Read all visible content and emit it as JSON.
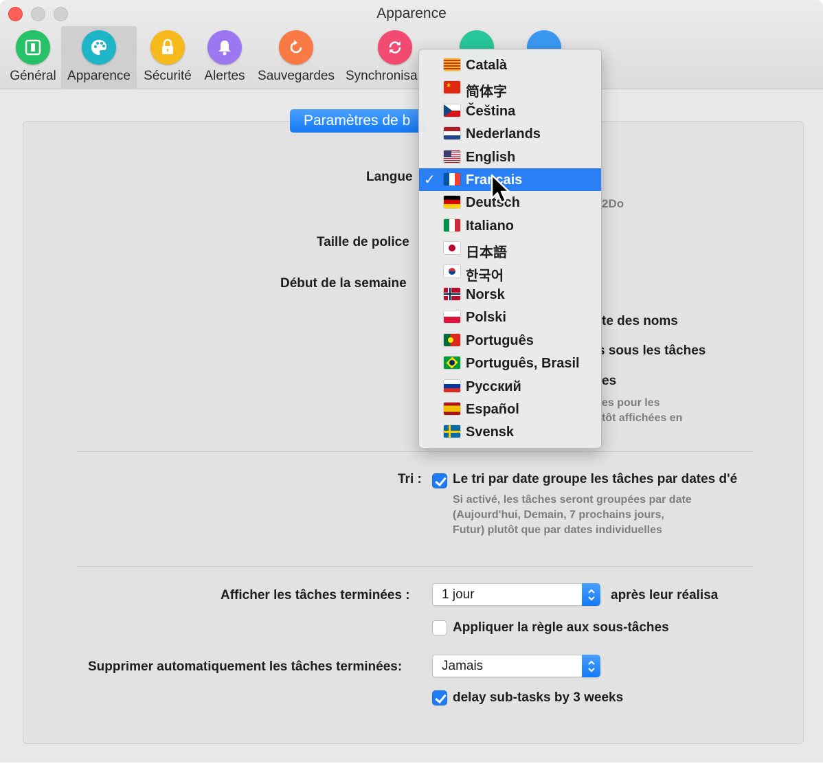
{
  "window": {
    "title": "Apparence"
  },
  "toolbar": {
    "items": [
      {
        "label": "Général",
        "color": "#27c267",
        "icon": "general-icon"
      },
      {
        "label": "Apparence",
        "color": "#1fb5c8",
        "icon": "palette-icon"
      },
      {
        "label": "Sécurité",
        "color": "#f6b91c",
        "icon": "lock-icon"
      },
      {
        "label": "Alertes",
        "color": "#9d77f1",
        "icon": "bell-icon"
      },
      {
        "label": "Sauvegardes",
        "color": "#f97a45",
        "icon": "backup-icon"
      },
      {
        "label": "Synchronisa",
        "color": "#f24a71",
        "icon": "sync-icon"
      }
    ],
    "hidden_icons": [
      {
        "color": "#27c79a",
        "icon": "sliders-icon"
      },
      {
        "color": "#3a98f3",
        "icon": "compass-icon"
      }
    ]
  },
  "segment": {
    "label": "Paramètres de b"
  },
  "form": {
    "language_label": "Langue",
    "language_hint_fragment": "2Do",
    "font_size_label": "Taille de police",
    "week_start_label": "Début de la semaine",
    "behind_menu_1": "te des noms",
    "behind_menu_2": "s sous les tâches",
    "behind_menu_3": "es",
    "behind_menu_hint": "es pour les\ntôt affichées en",
    "sort_label": "Tri :",
    "sort_checkbox_text": "Le tri par date groupe les tâches par dates d'é",
    "sort_hint": "Si activé, les tâches seront groupées par date (Aujourd'hui, Demain, 7 prochains jours, Futur) plutôt que par dates individuelles",
    "show_completed_label": "Afficher les tâches terminées :",
    "show_completed_value": "1 jour",
    "show_completed_suffix": "après leur réalisa",
    "apply_subtasks_label": "Appliquer la règle aux sous-tâches",
    "auto_delete_label": "Supprimer automatiquement les tâches terminées:",
    "auto_delete_value": "Jamais",
    "delay_subtasks_label": "delay sub-tasks by 3 weeks"
  },
  "language_menu": {
    "selected_index": 5,
    "items": [
      {
        "label": "Català",
        "flag": "ca"
      },
      {
        "label": "简体字",
        "flag": "cn"
      },
      {
        "label": "Čeština",
        "flag": "cz"
      },
      {
        "label": "Nederlands",
        "flag": "nl"
      },
      {
        "label": "English",
        "flag": "us"
      },
      {
        "label": "Français",
        "flag": "fr"
      },
      {
        "label": "Deutsch",
        "flag": "de"
      },
      {
        "label": "Italiano",
        "flag": "it"
      },
      {
        "label": "日本語",
        "flag": "jp"
      },
      {
        "label": "한국어",
        "flag": "kr"
      },
      {
        "label": "Norsk",
        "flag": "no"
      },
      {
        "label": "Polski",
        "flag": "pl"
      },
      {
        "label": "Português",
        "flag": "pt"
      },
      {
        "label": "Português, Brasil",
        "flag": "br"
      },
      {
        "label": "Русский",
        "flag": "ru"
      },
      {
        "label": "Español",
        "flag": "es"
      },
      {
        "label": "Svensk",
        "flag": "se"
      }
    ]
  },
  "colors": {
    "accent": "#1f7cf6",
    "menu_highlight": "#2a7ff5"
  }
}
